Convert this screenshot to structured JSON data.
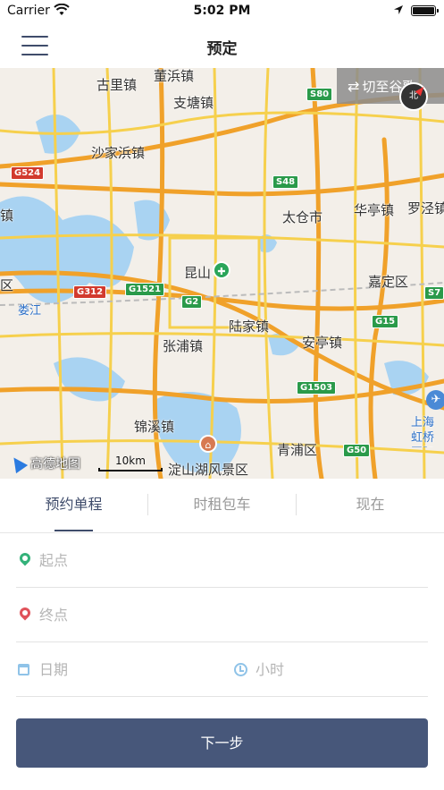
{
  "status_bar": {
    "carrier": "Carrier",
    "time": "5:02 PM"
  },
  "nav": {
    "title": "预定",
    "menu_icon": "hamburger-icon"
  },
  "map": {
    "switch_label": "切至谷歌",
    "compass_label": "北",
    "brand": "高德地图",
    "scale": "10km",
    "places": [
      "古里镇",
      "董浜镇",
      "支塘镇",
      "沙家浜镇",
      "太仓市",
      "华亭镇",
      "罗泾镇",
      "昆山",
      "陆家镇",
      "张浦镇",
      "安亭镇",
      "嘉定区",
      "锦溪镇",
      "青浦区",
      "淀山湖风景区",
      "上海虹桥国际机场",
      "娄江",
      "镇",
      "区"
    ],
    "roads": [
      "S80",
      "G524",
      "S48",
      "G312",
      "G1521",
      "G2",
      "G15",
      "G1503",
      "G50",
      "S7"
    ]
  },
  "tabs": [
    {
      "label": "预约单程",
      "active": true
    },
    {
      "label": "时租包车",
      "active": false
    },
    {
      "label": "现在",
      "active": false
    }
  ],
  "form": {
    "start_placeholder": "起点",
    "end_placeholder": "终点",
    "date_placeholder": "日期",
    "hours_placeholder": "小时"
  },
  "next_button": "下一步",
  "colors": {
    "primary": "#47577a",
    "start_pin": "#34b27a",
    "end_pin": "#e0525a",
    "accent_icon": "#8fc3e8"
  }
}
